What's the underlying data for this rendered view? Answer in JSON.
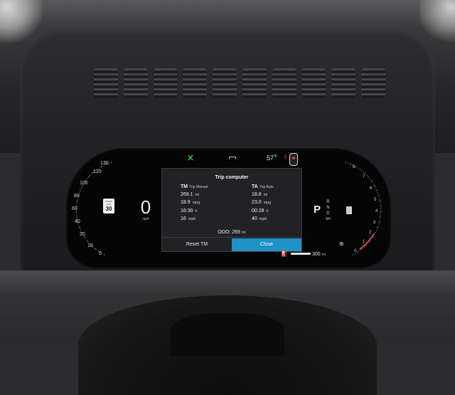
{
  "status_bar": {
    "temperature": "57",
    "temperature_unit": "°F"
  },
  "speedometer": {
    "ticks": [
      "130",
      "120",
      "100",
      "80",
      "60",
      "40",
      "20",
      "10",
      "0"
    ],
    "speed_limit_top": "SPEED LIMIT",
    "speed_limit": "30",
    "speed": "0",
    "unit": "mph"
  },
  "trip_computer": {
    "title": "Trip computer",
    "manual": {
      "abbr": "TM",
      "name": "Trip Manual",
      "rows": [
        {
          "value": "269.1",
          "unit": "mi"
        },
        {
          "value": "18.9",
          "unit": "mpg"
        },
        {
          "value": "16:30",
          "unit": "h"
        },
        {
          "value": "16",
          "unit": "mph"
        }
      ]
    },
    "auto": {
      "abbr": "TA",
      "name": "Trip Auto",
      "rows": [
        {
          "value": "18.8",
          "unit": "mi"
        },
        {
          "value": "23.0",
          "unit": "mpg"
        },
        {
          "value": "00:28",
          "unit": "h"
        },
        {
          "value": "40",
          "unit": "mph"
        }
      ]
    },
    "odo_label": "ODO:",
    "odo_value": "269",
    "odo_unit": "mi",
    "reset_label": "Reset TM",
    "close_label": "Close",
    "accent": "#1f92c8"
  },
  "gear": {
    "current": "P",
    "list": [
      "R",
      "N",
      "D"
    ],
    "manual": "-M+"
  },
  "tachometer": {
    "ticks": [
      "8",
      "7",
      "6",
      "5",
      "4",
      "3",
      "2",
      "1",
      "0"
    ]
  },
  "range": {
    "value": "300",
    "unit": "mi"
  }
}
